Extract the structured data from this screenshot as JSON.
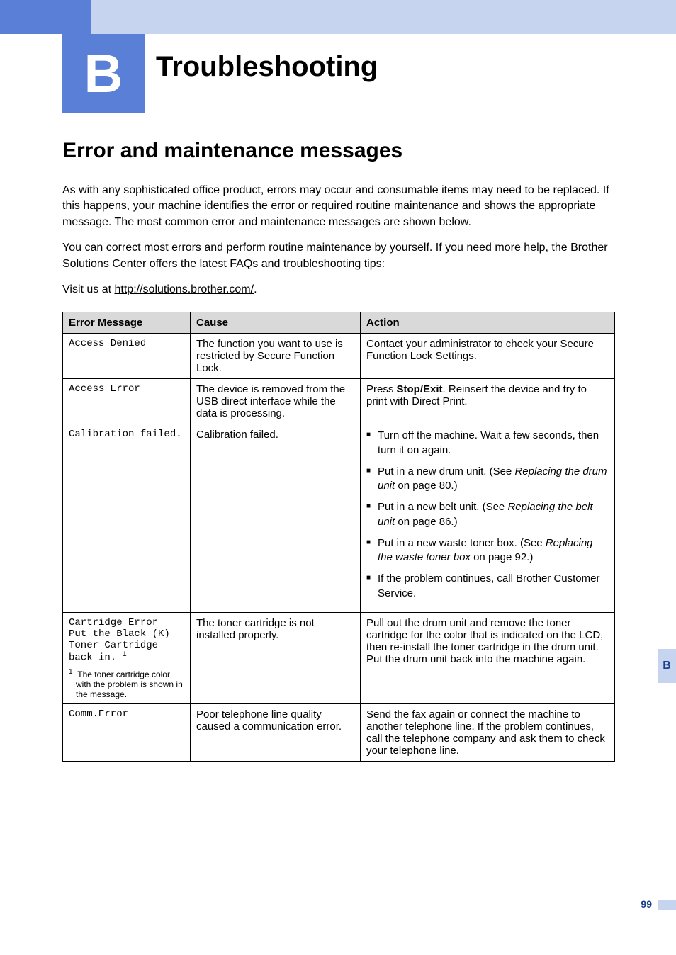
{
  "appendix_letter": "B",
  "page_title": "Troubleshooting",
  "section_title": "Error and maintenance messages",
  "intro_p1": "As with any sophisticated office product, errors may occur and consumable items may need to be replaced. If this happens, your machine identifies the error or required routine maintenance and shows the appropriate message. The most common error and maintenance messages are shown below.",
  "intro_p2": "You can correct most errors and perform routine maintenance by yourself. If you need more help, the Brother Solutions Center offers the latest FAQs and troubleshooting tips:",
  "intro_p3_prefix": "Visit us at ",
  "intro_p3_link": "http://solutions.brother.com/",
  "intro_p3_suffix": ".",
  "table": {
    "headers": [
      "Error Message",
      "Cause",
      "Action"
    ],
    "rows": [
      {
        "msg": "Access Denied",
        "cause": "The function you want to use is restricted by Secure Function Lock.",
        "action_text": "Contact your administrator to check your Secure Function Lock Settings."
      },
      {
        "msg": "Access Error",
        "cause": "The device is removed from the USB direct interface while the data is processing.",
        "action_prefix": "Press ",
        "action_bold": "Stop/Exit",
        "action_suffix": ". Reinsert the device and try to print with Direct Print."
      },
      {
        "msg": "Calibration failed.",
        "cause": "Calibration failed.",
        "action_list": [
          {
            "text": "Turn off the machine. Wait a few seconds, then turn it on again."
          },
          {
            "prefix": "Put in a new drum unit. (See ",
            "ital": "Replacing the drum unit",
            "suffix": " on page 80.)"
          },
          {
            "prefix": "Put in a new belt unit. (See ",
            "ital": "Replacing the belt unit",
            "suffix": " on page 86.)"
          },
          {
            "prefix": "Put in a new waste toner box. (See ",
            "ital": "Replacing the waste toner box",
            "suffix": " on page 92.)"
          },
          {
            "text": "If the problem continues, call Brother Customer Service."
          }
        ]
      },
      {
        "msg_lines": [
          "Cartridge Error",
          "Put the Black (K)",
          "Toner Cartridge",
          "back in."
        ],
        "footnote_num": "1",
        "footnote": "The toner cartridge color with the problem is shown in the message.",
        "cause": "The toner cartridge is not installed properly.",
        "action_text": "Pull out the drum unit and remove the toner cartridge for the color that is indicated on the LCD, then re-install the toner cartridge in the drum unit. Put the drum unit back into the machine again."
      },
      {
        "msg": "Comm.Error",
        "cause": "Poor telephone line quality caused a communication error.",
        "action_text": "Send the fax again or connect the machine to another telephone line. If the problem continues, call the telephone company and ask them to check your telephone line."
      }
    ]
  },
  "side_tab": "B",
  "page_number": "99"
}
